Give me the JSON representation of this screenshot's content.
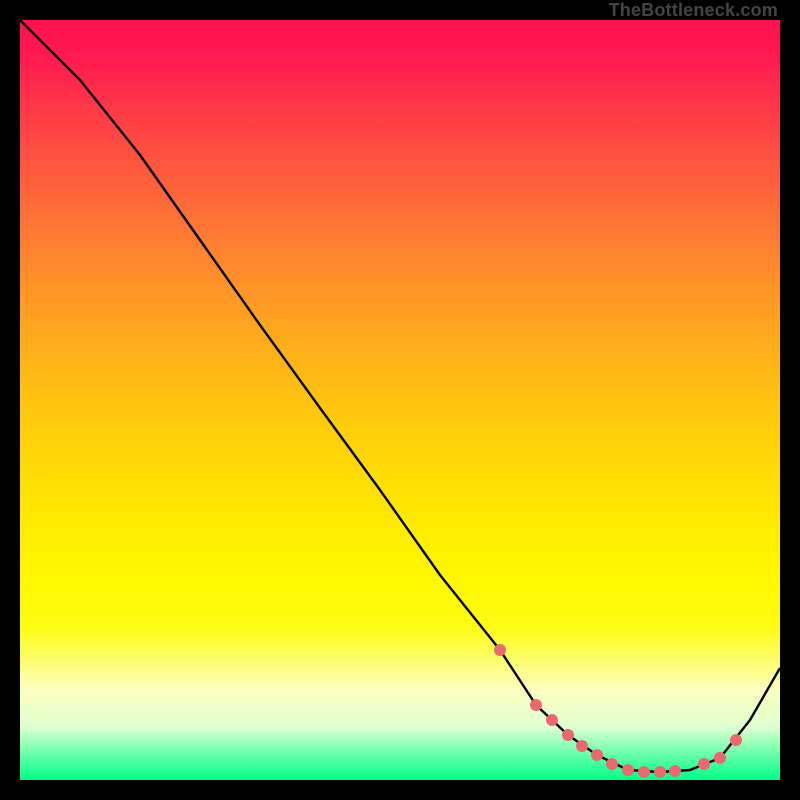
{
  "watermark": "TheBottleneck.com",
  "chart_data": {
    "type": "line",
    "title": "",
    "xlabel": "",
    "ylabel": "",
    "xlim": [
      0,
      100
    ],
    "ylim": [
      0,
      100
    ],
    "series": [
      {
        "name": "bottleneck-curve",
        "x": [
          0,
          8,
          16,
          24,
          32,
          40,
          48,
          56,
          63,
          68,
          72,
          76,
          80,
          84,
          88,
          92,
          96,
          100
        ],
        "y": [
          100,
          92,
          82,
          71,
          60,
          49,
          38,
          27,
          17,
          10,
          6,
          3,
          1,
          1,
          1,
          3,
          8,
          15
        ]
      }
    ],
    "markers": {
      "name": "highlight-dots",
      "x": [
        63,
        68,
        70,
        72,
        74,
        76,
        78,
        80,
        82,
        84,
        86,
        90,
        92,
        94
      ],
      "y": [
        17,
        9,
        7,
        5,
        3,
        2,
        1,
        1,
        1,
        1,
        1,
        2,
        4,
        6
      ],
      "color": "#e96a6e"
    },
    "background_gradient": {
      "from": "#ff1152",
      "to": "#00ff88",
      "direction": "top-to-bottom"
    }
  }
}
